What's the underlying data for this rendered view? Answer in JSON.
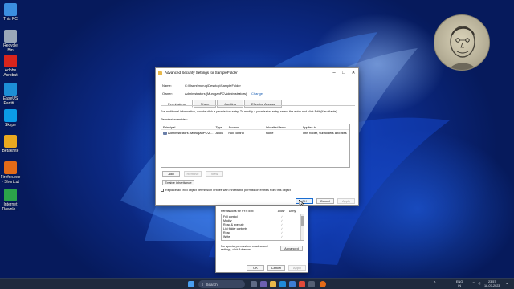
{
  "desktop": {
    "icons": [
      {
        "name": "this-pc",
        "label": "This PC",
        "color": "#3b8fe0"
      },
      {
        "name": "recycle-bin",
        "label": "Recycle Bin",
        "color": "#9aa7b8"
      },
      {
        "name": "adobe-acrobat",
        "label": "Adobe Acrobat",
        "color": "#d9251d"
      },
      {
        "name": "easeus",
        "label": "EaseUS Partiti...",
        "color": "#1d8fd6"
      },
      {
        "name": "skype",
        "label": "Skype",
        "color": "#0b9ce8"
      },
      {
        "name": "betaknite",
        "label": "Betaknite",
        "color": "#e9a820"
      },
      {
        "name": "firefox",
        "label": "Firefox.exe - Shortcut",
        "color": "#e36b18"
      },
      {
        "name": "internet-download",
        "label": "Internet Downlo...",
        "color": "#2ba34a"
      }
    ]
  },
  "dialog": {
    "title": "Advanced Security Settings for SampleFolder",
    "name_label": "Name:",
    "name_value": "C:\\Users\\murug\\Desktop\\SampleFolder",
    "owner_label": "Owner:",
    "owner_value": "Administrators (MuruganPC\\Administrators)",
    "change_link": "Change",
    "tabs": [
      "Permissions",
      "Share",
      "Auditing",
      "Effective Access"
    ],
    "info_text": "For additional information, double-click a permission entry. To modify a permission entry, select the entry and click Edit (if available).",
    "entries_label": "Permission entries:",
    "columns": [
      "Principal",
      "Type",
      "Access",
      "Inherited from",
      "Applies to"
    ],
    "rows": [
      [
        "Administrators (MuruganPC\\A...",
        "Allow",
        "Full control",
        "None",
        "This folder, subfolders and files"
      ]
    ],
    "buttons": {
      "add": "Add",
      "remove": "Remove",
      "view": "View",
      "enable_inheritance": "Enable inheritance",
      "ok": "OK",
      "cancel": "Cancel",
      "apply": "Apply"
    },
    "replace_label": "Replace all child object permission entries with inheritable permission entries from this object"
  },
  "dialog2": {
    "header_perm": "Permissions for SYSTEM",
    "header_allow": "Allow",
    "header_deny": "Deny",
    "perms": [
      "Full control",
      "Modify",
      "Read & execute",
      "List folder contents",
      "Read",
      "Write"
    ],
    "special_text": "For special permissions or advanced settings, click Advanced.",
    "advanced": "Advanced",
    "ok": "OK",
    "cancel": "Cancel",
    "apply": "Apply"
  },
  "taskbar": {
    "search_placeholder": "Search",
    "lang_top": "ENG",
    "lang_bottom": "IN",
    "time": "23:57",
    "date": "18-07-2023"
  }
}
